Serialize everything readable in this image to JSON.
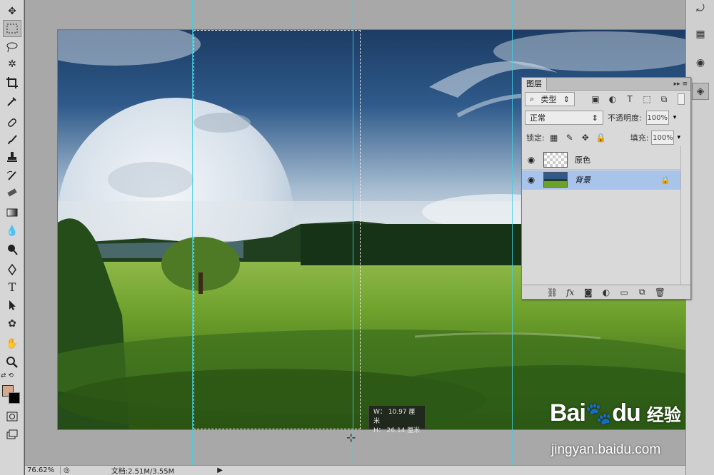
{
  "status": {
    "zoom": "76.62%",
    "doc": "文档:2.51M/3.55M"
  },
  "size_tip": {
    "w": "W： 10.97 厘米",
    "h": "H： 26.14 厘米"
  },
  "layers_panel": {
    "tab": "图层",
    "filter": "类型",
    "blend_mode": "正常",
    "opacity_label": "不透明度:",
    "opacity": "100%",
    "lock_label": "锁定:",
    "fill_label": "填充:",
    "fill": "100%",
    "layers": [
      {
        "name": "原色",
        "selected": false
      },
      {
        "name": "背景",
        "selected": true,
        "locked": true
      }
    ]
  },
  "watermark": {
    "logo": "Bai",
    "logo2": "du",
    "cn": "经验",
    "url": "jingyan.baidu.com"
  },
  "colors": {
    "guide": "#3fd0e0",
    "selection": "#a8c4ea",
    "foreground": "#d8a88e",
    "background": "#000000"
  },
  "tools": [
    "move-icon",
    "marquee-icon",
    "lasso-icon",
    "magic-wand-icon",
    "crop-icon",
    "eyedropper-icon",
    "healing-icon",
    "brush-icon",
    "stamp-icon",
    "history-brush-icon",
    "eraser-icon",
    "gradient-icon",
    "blur-icon",
    "dodge-icon",
    "pen-icon",
    "type-icon",
    "path-select-icon",
    "shape-icon",
    "hand-icon",
    "zoom-icon"
  ]
}
